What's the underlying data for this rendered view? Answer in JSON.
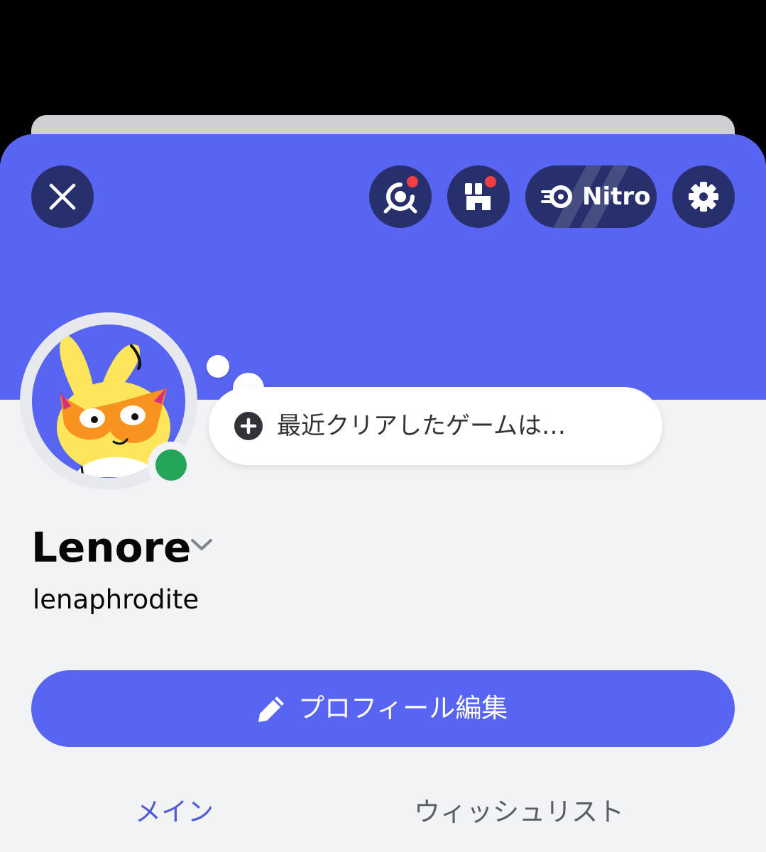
{
  "header": {
    "close_icon": "close-icon",
    "quests_icon": "quests-icon",
    "shop_icon": "shop-icon",
    "nitro_label": "Nitro",
    "settings_icon": "gear-icon"
  },
  "profile": {
    "status_bubble": "最近クリアしたゲームは…",
    "display_name": "Lenore",
    "username": "lenaphrodite",
    "edit_button_label": "プロフィール編集",
    "online_status_color": "#23a55a"
  },
  "tabs": [
    {
      "label": "メイン"
    },
    {
      "label": "ウィッシュリスト"
    }
  ],
  "colors": {
    "brand": "#5865f2",
    "button_dark": "#27306d",
    "notification": "#f23f43"
  }
}
